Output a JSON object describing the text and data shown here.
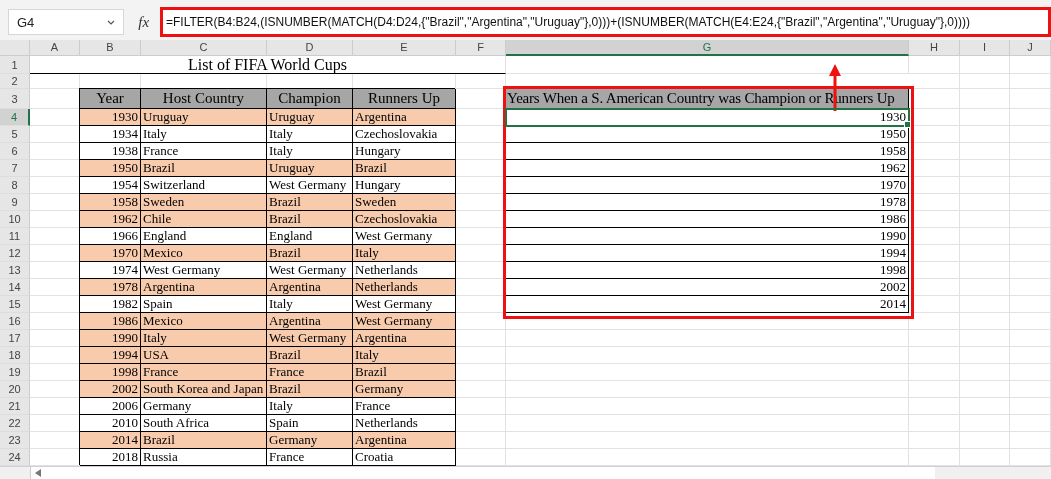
{
  "name_box": "G4",
  "function_label": "fx",
  "formula": "=FILTER(B4:B24,(ISNUMBER(MATCH(D4:D24,{\"Brazil\",\"Argentina\",\"Uruguay\"},0)))+(ISNUMBER(MATCH(E4:E24,{\"Brazil\",\"Argentina\",\"Uruguay\"},0))))",
  "column_headers": [
    {
      "label": "A",
      "selected": false
    },
    {
      "label": "B",
      "selected": false
    },
    {
      "label": "C",
      "selected": false
    },
    {
      "label": "D",
      "selected": false
    },
    {
      "label": "E",
      "selected": false
    },
    {
      "label": "F",
      "selected": false
    },
    {
      "label": "G",
      "selected": true
    },
    {
      "label": "H",
      "selected": false
    },
    {
      "label": "I",
      "selected": false
    },
    {
      "label": "J",
      "selected": false
    }
  ],
  "row_headers": [
    {
      "label": "1",
      "selected": false
    },
    {
      "label": "2",
      "selected": false
    },
    {
      "label": "3",
      "selected": false
    },
    {
      "label": "4",
      "selected": true
    },
    {
      "label": "5",
      "selected": false
    },
    {
      "label": "6",
      "selected": false
    },
    {
      "label": "7",
      "selected": false
    },
    {
      "label": "8",
      "selected": false
    },
    {
      "label": "9",
      "selected": false
    },
    {
      "label": "10",
      "selected": false
    },
    {
      "label": "11",
      "selected": false
    },
    {
      "label": "12",
      "selected": false
    },
    {
      "label": "13",
      "selected": false
    },
    {
      "label": "14",
      "selected": false
    },
    {
      "label": "15",
      "selected": false
    },
    {
      "label": "16",
      "selected": false
    },
    {
      "label": "17",
      "selected": false
    },
    {
      "label": "18",
      "selected": false
    },
    {
      "label": "19",
      "selected": false
    },
    {
      "label": "20",
      "selected": false
    },
    {
      "label": "21",
      "selected": false
    },
    {
      "label": "22",
      "selected": false
    },
    {
      "label": "23",
      "selected": false
    },
    {
      "label": "24",
      "selected": false
    }
  ],
  "title": "List of FIFA World Cups",
  "table": {
    "columns": [
      "Year",
      "Host Country",
      "Champion",
      "Runners Up"
    ],
    "rows": [
      {
        "cells": [
          "1930",
          "Uruguay",
          "Uruguay",
          "Argentina"
        ],
        "highlighted": true
      },
      {
        "cells": [
          "1934",
          "Italy",
          "Italy",
          "Czechoslovakia"
        ],
        "highlighted": false
      },
      {
        "cells": [
          "1938",
          "France",
          "Italy",
          "Hungary"
        ],
        "highlighted": false
      },
      {
        "cells": [
          "1950",
          "Brazil",
          "Uruguay",
          "Brazil"
        ],
        "highlighted": true
      },
      {
        "cells": [
          "1954",
          "Switzerland",
          "West Germany",
          "Hungary"
        ],
        "highlighted": false
      },
      {
        "cells": [
          "1958",
          "Sweden",
          "Brazil",
          "Sweden"
        ],
        "highlighted": true
      },
      {
        "cells": [
          "1962",
          "Chile",
          "Brazil",
          "Czechoslovakia"
        ],
        "highlighted": true
      },
      {
        "cells": [
          "1966",
          "England",
          "England",
          "West Germany"
        ],
        "highlighted": false
      },
      {
        "cells": [
          "1970",
          "Mexico",
          "Brazil",
          "Italy"
        ],
        "highlighted": true
      },
      {
        "cells": [
          "1974",
          "West Germany",
          "West Germany",
          "Netherlands"
        ],
        "highlighted": false
      },
      {
        "cells": [
          "1978",
          "Argentina",
          "Argentina",
          "Netherlands"
        ],
        "highlighted": true
      },
      {
        "cells": [
          "1982",
          "Spain",
          "Italy",
          "West Germany"
        ],
        "highlighted": false
      },
      {
        "cells": [
          "1986",
          "Mexico",
          "Argentina",
          "West Germany"
        ],
        "highlighted": true
      },
      {
        "cells": [
          "1990",
          "Italy",
          "West Germany",
          "Argentina"
        ],
        "highlighted": true
      },
      {
        "cells": [
          "1994",
          "USA",
          "Brazil",
          "Italy"
        ],
        "highlighted": true
      },
      {
        "cells": [
          "1998",
          "France",
          "France",
          "Brazil"
        ],
        "highlighted": true
      },
      {
        "cells": [
          "2002",
          "South Korea and Japan",
          "Brazil",
          "Germany"
        ],
        "highlighted": true
      },
      {
        "cells": [
          "2006",
          "Germany",
          "Italy",
          "France"
        ],
        "highlighted": false
      },
      {
        "cells": [
          "2010",
          "South Africa",
          "Spain",
          "Netherlands"
        ],
        "highlighted": false
      },
      {
        "cells": [
          "2014",
          "Brazil",
          "Germany",
          "Argentina"
        ],
        "highlighted": true
      },
      {
        "cells": [
          "2018",
          "Russia",
          "France",
          "Croatia"
        ],
        "highlighted": false
      }
    ]
  },
  "result": {
    "header": "Years When a S. American Country was Champion or Runners Up",
    "values": [
      {
        "text": "1930",
        "selected": true
      },
      {
        "text": "1950",
        "selected": false
      },
      {
        "text": "1958",
        "selected": false
      },
      {
        "text": "1962",
        "selected": false
      },
      {
        "text": "1970",
        "selected": false
      },
      {
        "text": "1978",
        "selected": false
      },
      {
        "text": "1986",
        "selected": false
      },
      {
        "text": "1990",
        "selected": false
      },
      {
        "text": "1994",
        "selected": false
      },
      {
        "text": "1998",
        "selected": false
      },
      {
        "text": "2002",
        "selected": false
      },
      {
        "text": "2014",
        "selected": false
      }
    ]
  }
}
